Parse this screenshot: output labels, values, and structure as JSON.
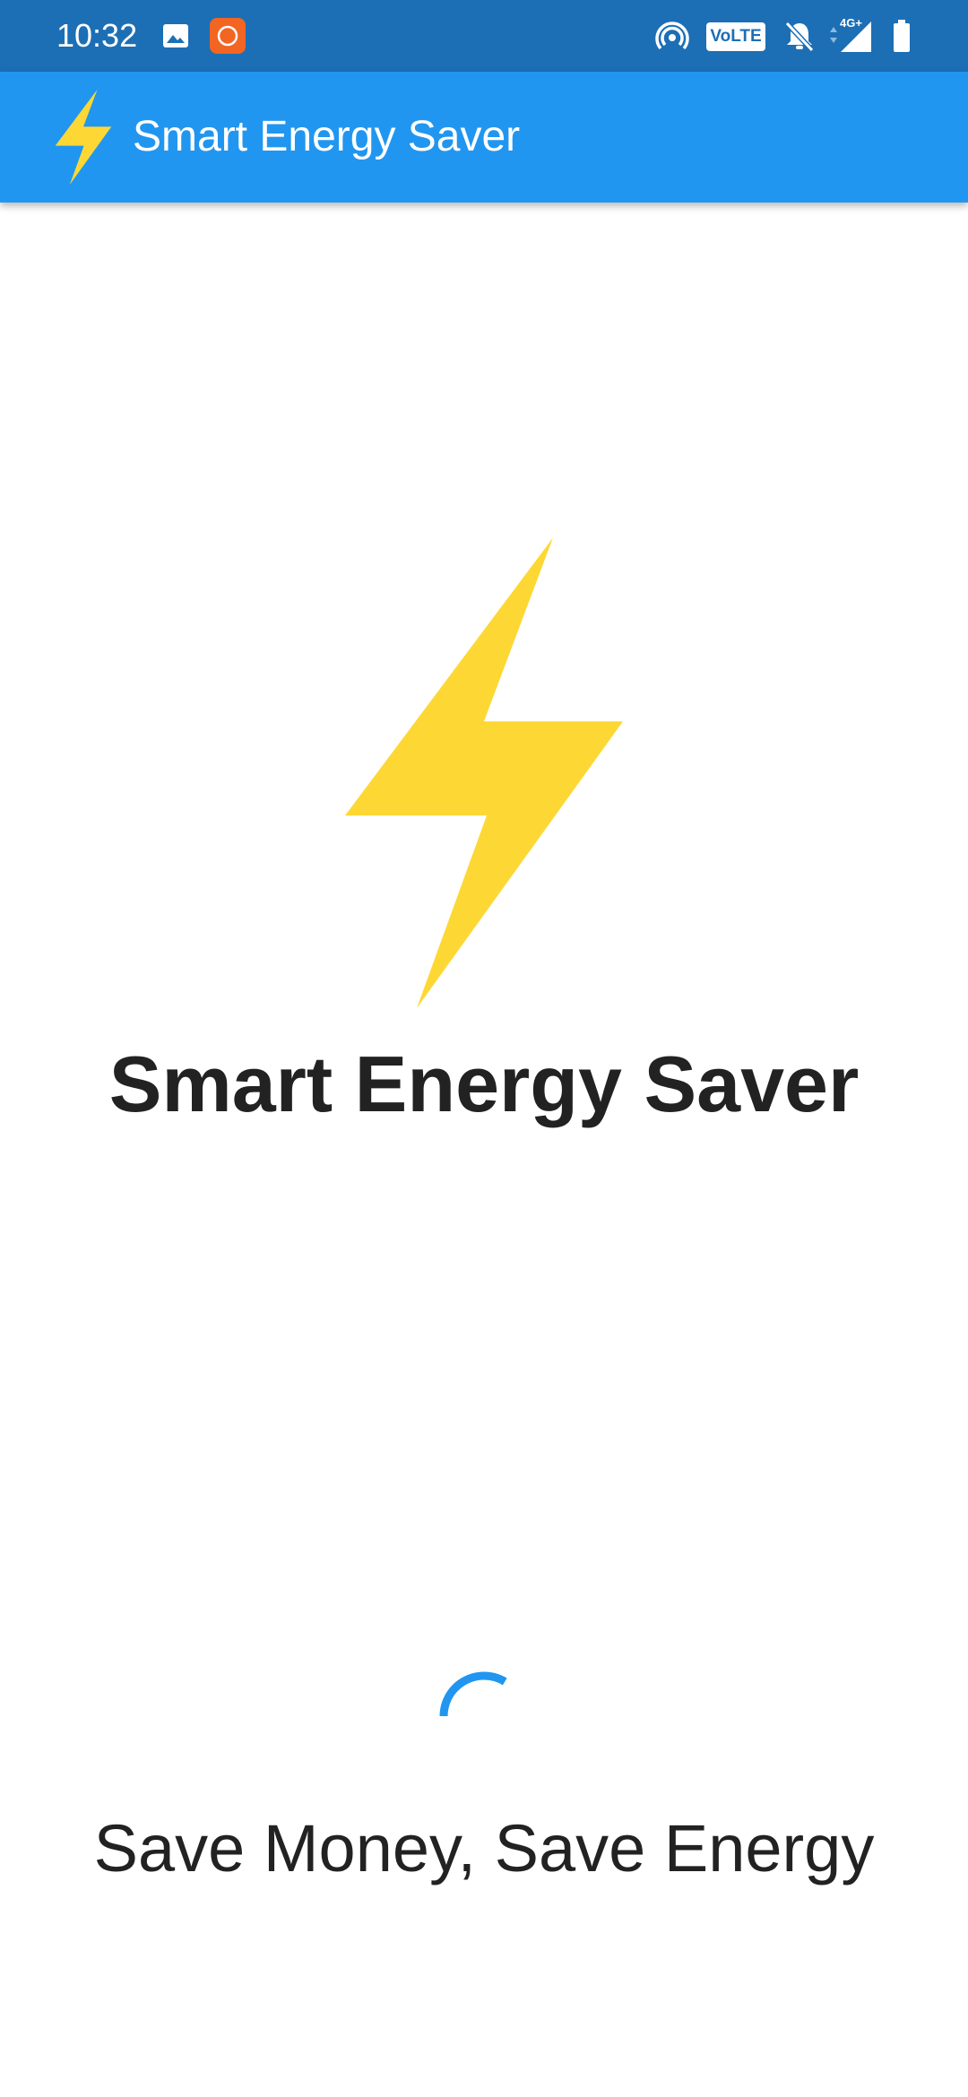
{
  "status_bar": {
    "time": "10:32",
    "volte_label": "VoLTE",
    "network_label": "4G+",
    "icons": [
      "image-icon",
      "app-notification-icon",
      "hotspot-icon",
      "volte-icon",
      "bell-off-icon",
      "signal-icon",
      "battery-icon"
    ],
    "background_color": "#1c6fb5"
  },
  "app_bar": {
    "title": "Smart Energy Saver",
    "icon": "lightning-bolt-icon",
    "background_color": "#2196f0"
  },
  "splash": {
    "title": "Smart Energy Saver",
    "tagline": "Save Money, Save Energy",
    "logo_icon": "lightning-bolt-icon",
    "logo_color": "#fdd835",
    "loading_indicator": "progress-spinner-icon",
    "spinner_color": "#2196f0"
  }
}
